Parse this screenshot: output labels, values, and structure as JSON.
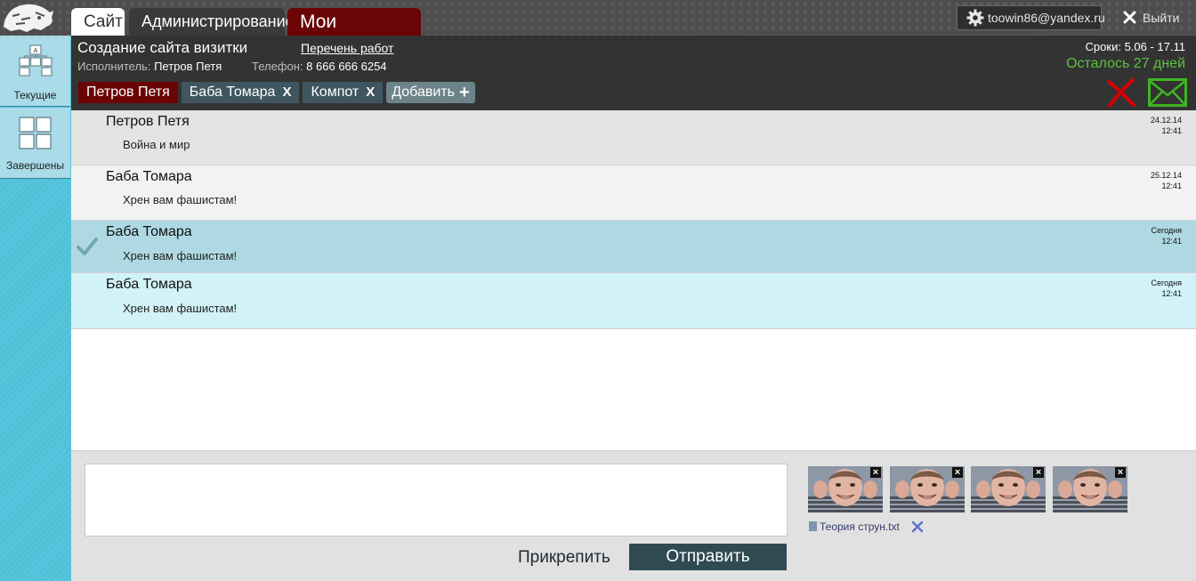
{
  "topbar": {
    "tabs": [
      "Сайт",
      "Администрирование",
      "Мои проекты"
    ],
    "user_email": "toowin86@yandex.ru",
    "logout_label": "Выйти"
  },
  "sidebar": {
    "items": [
      {
        "label": "Текущие",
        "icon": "sitemap-icon"
      },
      {
        "label": "Завершены",
        "icon": "grid-icon"
      }
    ]
  },
  "header": {
    "title": "Создание сайта визитки",
    "work_list_link": "Перечень работ",
    "executor_label": "Исполнитель:",
    "executor_name": "Петров Петя",
    "phone_label": "Телефон:",
    "phone_value": "8 666 666 6254",
    "dates": "Сроки: 5.06 - 17.11",
    "days_left": "Осталось 27 дней",
    "participants": [
      {
        "name": "Петров Петя",
        "removable": false
      },
      {
        "name": "Баба Томара",
        "removable": true,
        "remove_label": "X"
      },
      {
        "name": "Компот",
        "removable": true,
        "remove_label": "X"
      }
    ],
    "add_label": "Добавить",
    "add_symbol": "+"
  },
  "messages": [
    {
      "author": "Петров Петя",
      "text": "Война и мир",
      "date": "24.12.14",
      "time": "12:41",
      "bg": "#e4e3e4",
      "read": false
    },
    {
      "author": "Баба Томара",
      "text": "Хрен вам фашистам!",
      "date": "25.12.14",
      "time": "12:41",
      "bg": "#f2f2f2",
      "read": false
    },
    {
      "author": "Баба Томара",
      "text": "Хрен вам фашистам!",
      "date": "Сегодня",
      "time": "12:41",
      "bg": "#aed9e2",
      "read": true
    },
    {
      "author": "Баба Томара",
      "text": "Хрен вам фашистам!",
      "date": "Сегодня",
      "time": "12:41",
      "bg": "#d1f2f8",
      "read": false
    }
  ],
  "compose": {
    "message_value": "",
    "attach_label": "Прикрепить",
    "send_label": "Отправить",
    "thumbnail_count": 4,
    "thumbnail_close": "×",
    "file_name": "Теория струн.txt"
  },
  "colors": {
    "accent_red": "#6b0404",
    "days_left_green": "#58c33c",
    "send_button": "#2f4a52",
    "sidebar_blue": "#55c6dc"
  }
}
